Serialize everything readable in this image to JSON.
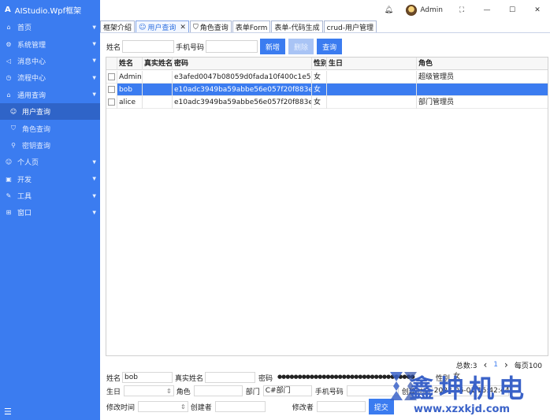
{
  "app": {
    "title": "AIStudio.Wpf框架"
  },
  "sidebar": {
    "items": [
      {
        "icon": "⌂",
        "label": "首页",
        "expandable": true
      },
      {
        "icon": "⚙",
        "label": "系统管理",
        "expandable": true
      },
      {
        "icon": "◁",
        "label": "消息中心",
        "expandable": true
      },
      {
        "icon": "◷",
        "label": "流程中心",
        "expandable": true
      },
      {
        "icon": "⌂",
        "label": "通用查询",
        "expandable": true
      },
      {
        "icon": "☺",
        "label": "用户查询",
        "sub": true,
        "active": true
      },
      {
        "icon": "⛉",
        "label": "角色查询",
        "sub": true
      },
      {
        "icon": "⚲",
        "label": "密钥查询",
        "sub": true
      },
      {
        "icon": "☺",
        "label": "个人页",
        "expandable": true
      },
      {
        "icon": "▣",
        "label": "开发",
        "expandable": true
      },
      {
        "icon": "✎",
        "label": "工具",
        "expandable": true
      },
      {
        "icon": "⊞",
        "label": "窗口",
        "expandable": true
      }
    ],
    "menu_glyph": "☰"
  },
  "topbar": {
    "bell_glyph": "🔔",
    "user_name": "Admin",
    "fullscreen_glyph": "⛶",
    "minimize_glyph": "—",
    "maximize_glyph": "☐",
    "close_glyph": "✕"
  },
  "tabs": [
    {
      "label": "框架介绍",
      "icon": ""
    },
    {
      "label": "用户查询",
      "icon": "☺",
      "active": true,
      "closable": true
    },
    {
      "label": "角色查询",
      "icon": "⛉"
    },
    {
      "label": "表单Form",
      "icon": ""
    },
    {
      "label": "表单-代码生成",
      "icon": ""
    },
    {
      "label": "crud-用户管理",
      "icon": ""
    }
  ],
  "search": {
    "name_label": "姓名",
    "name_value": "",
    "phone_label": "手机号码",
    "phone_value": "",
    "add_label": "新增",
    "delete_label": "删除",
    "query_label": "查询"
  },
  "table": {
    "columns": [
      "",
      "姓名",
      "真实姓名",
      "密码",
      "性别",
      "生日",
      "角色"
    ],
    "rows": [
      {
        "name": "Admin",
        "real_name": "",
        "password": "e3afed0047b08059d0fada10f400c1e5",
        "gender": "女",
        "birthday": "",
        "role": "超级管理员",
        "selected": false
      },
      {
        "name": "bob",
        "real_name": "",
        "password": "e10adc3949ba59abbe56e057f20f883e",
        "gender": "女",
        "birthday": "",
        "role": "",
        "selected": true
      },
      {
        "name": "alice",
        "real_name": "",
        "password": "e10adc3949ba59abbe56e057f20f883e",
        "gender": "女",
        "birthday": "",
        "role": "部门管理员",
        "selected": false
      }
    ]
  },
  "pager": {
    "total_label": "总数:3",
    "prev_glyph": "‹",
    "current_page": "1",
    "next_glyph": "›",
    "page_size_label": "每页100"
  },
  "form": {
    "name_label": "姓名",
    "name_value": "bob",
    "real_name_label": "真实姓名",
    "real_name_value": "",
    "password_label": "密码",
    "password_value": "●●●●●●●●●●●●●●●●●●●●●●●●●●●●●●●●●●",
    "gender_label": "性别",
    "gender_value": "女",
    "birthday_label": "生日",
    "birthday_value": "",
    "role_label": "角色",
    "role_value": "",
    "dept_label": "部门",
    "dept_value": "C#部门",
    "phone_label": "手机号码",
    "phone_value": "",
    "created_label": "创建时间",
    "created_value": "2022-06-01 15:42:44",
    "modified_label": "修改时间",
    "modified_value": "",
    "creator_label": "创建者",
    "creator_value": "",
    "modifier_label": "修改者",
    "modifier_value": "",
    "submit_label": "提交"
  },
  "watermark": {
    "brand_text": "鑫坤机电",
    "url_text": "www.xzxkjd.com"
  }
}
